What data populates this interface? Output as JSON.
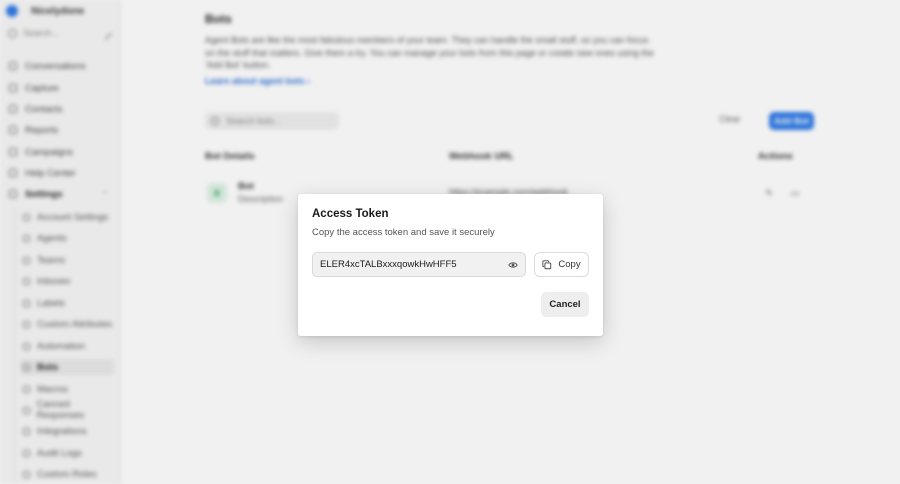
{
  "sidebar": {
    "brand": "Nicelydone",
    "search_placeholder": "Search...",
    "items": [
      {
        "label": "Conversations",
        "icon": "chat-icon"
      },
      {
        "label": "Capture",
        "icon": "capture-icon"
      },
      {
        "label": "Contacts",
        "icon": "contacts-icon"
      },
      {
        "label": "Reports",
        "icon": "reports-icon"
      },
      {
        "label": "Campaigns",
        "icon": "megaphone-icon"
      },
      {
        "label": "Help Center",
        "icon": "book-icon"
      },
      {
        "label": "Settings",
        "icon": "gear-icon"
      }
    ],
    "settings_items": [
      {
        "label": "Account Settings"
      },
      {
        "label": "Agents"
      },
      {
        "label": "Teams"
      },
      {
        "label": "Inboxes"
      },
      {
        "label": "Labels"
      },
      {
        "label": "Custom Attributes"
      },
      {
        "label": "Automation"
      },
      {
        "label": "Bots"
      },
      {
        "label": "Macros"
      },
      {
        "label": "Canned Responses"
      },
      {
        "label": "Integrations"
      },
      {
        "label": "Audit Logs"
      },
      {
        "label": "Custom Roles"
      }
    ],
    "active_item": "Bots"
  },
  "page": {
    "title": "Bots",
    "description": "Agent Bots are like the most fabulous members of your team. They can handle the small stuff, so you can focus on the stuff that matters. Give them a try. You can manage your bots from this page or create new ones using the 'Add Bot' button.",
    "learn_link": "Learn about agent bots",
    "search_placeholder": "Search bots...",
    "clear_label": "Clear",
    "add_label": "Add Bot"
  },
  "table": {
    "headers": [
      "Bot Details",
      "Webhook URL",
      "Actions"
    ],
    "rows": [
      {
        "avatar": "B",
        "name": "Bot",
        "description": "Description",
        "webhook": "https://example.com/webhook"
      }
    ]
  },
  "modal": {
    "title": "Access Token",
    "subtitle": "Copy the access token and save it securely",
    "token": "ELER4xcTALBxxxqowkHwHFF5",
    "copy_label": "Copy",
    "cancel_label": "Cancel"
  },
  "colors": {
    "accent": "#2f7be8",
    "bot_avatar_bg": "#dff3e6",
    "bot_avatar_fg": "#2a9d5b"
  }
}
